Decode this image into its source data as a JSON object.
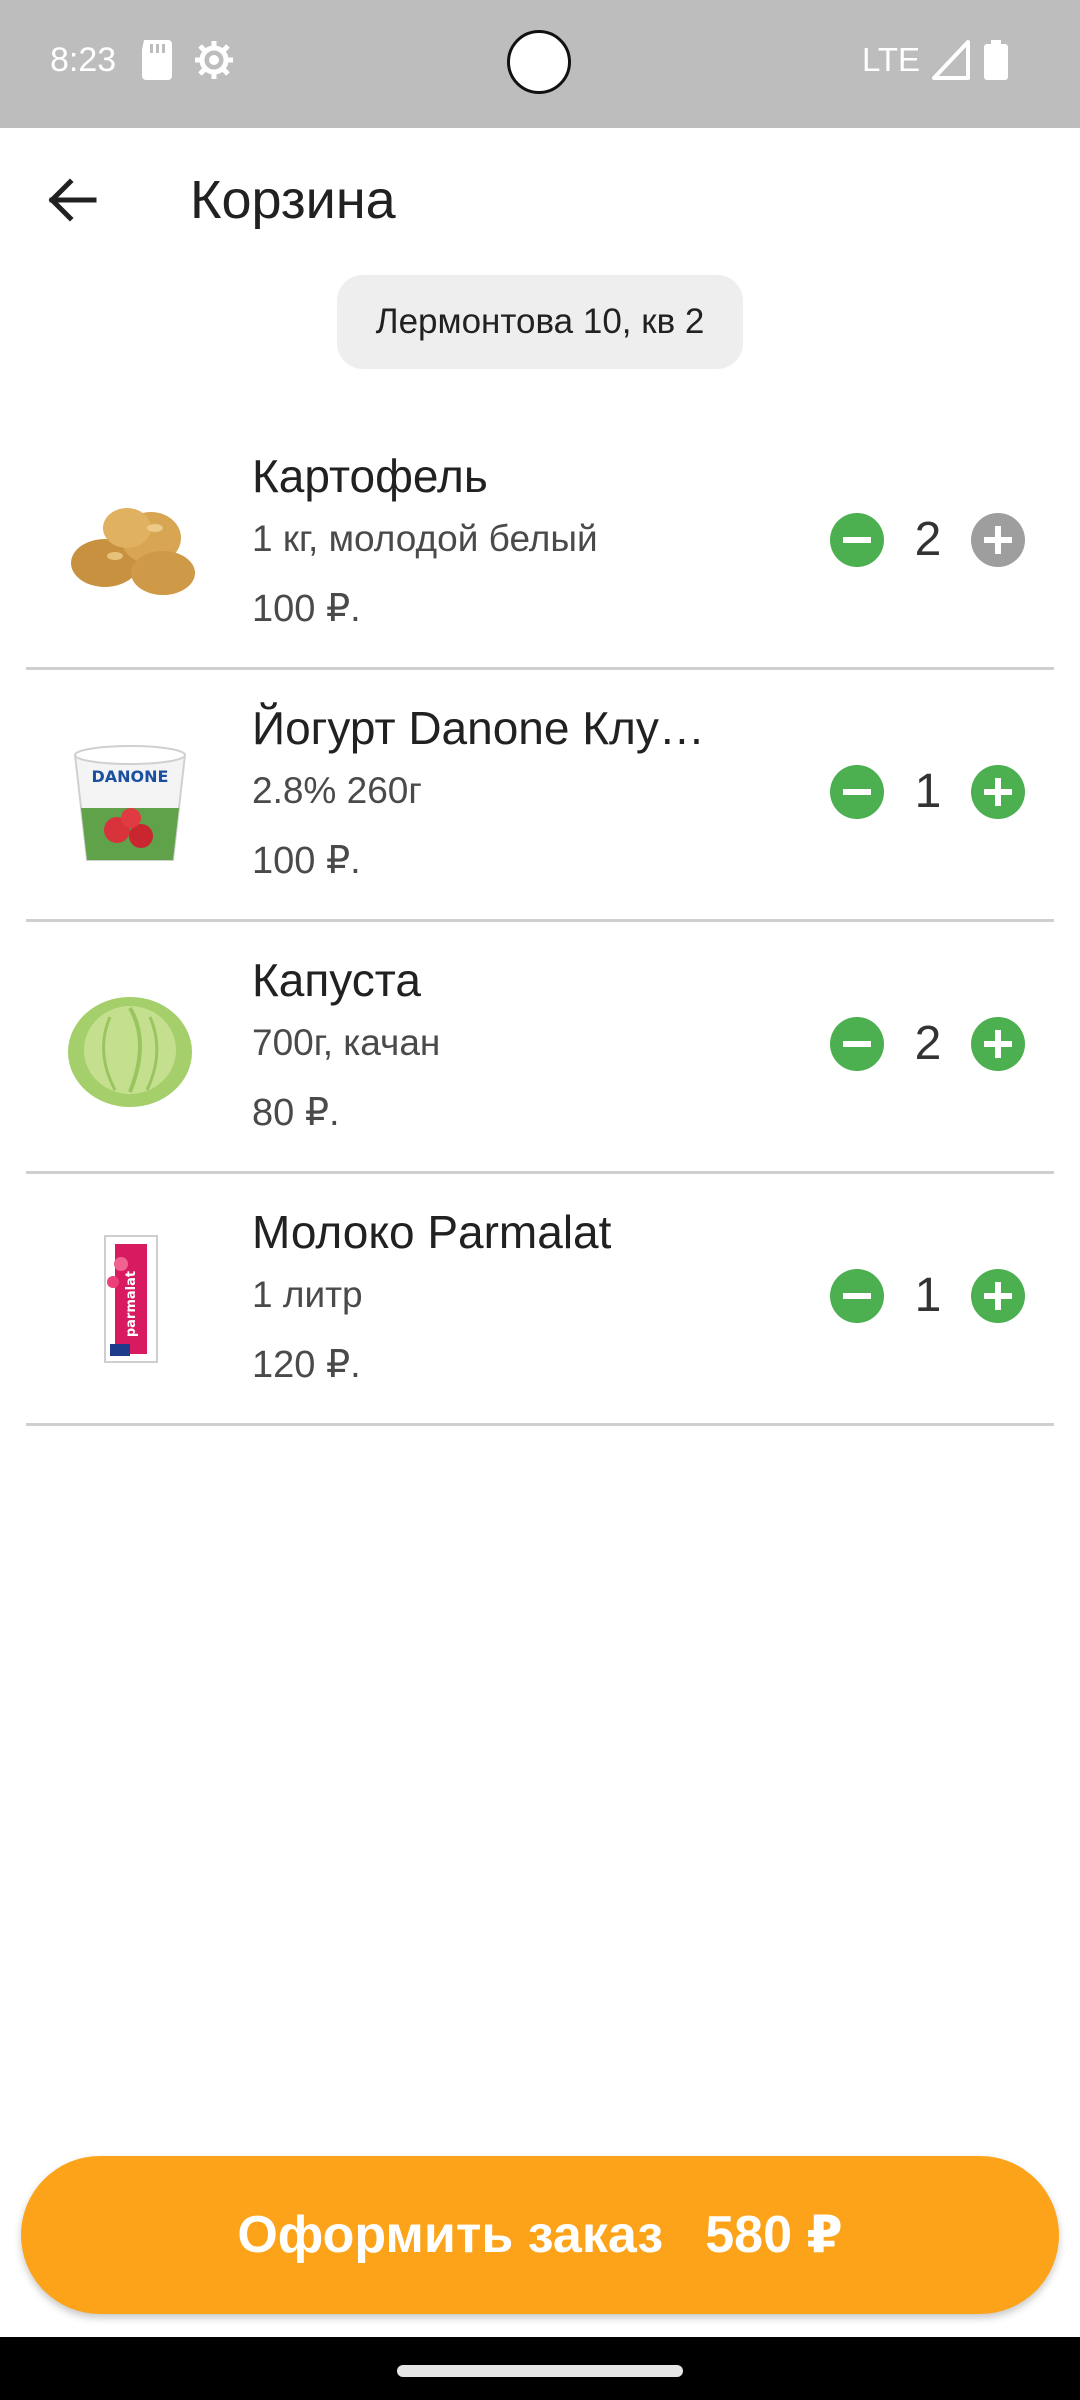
{
  "status_bar": {
    "time": "8:23",
    "network": "LTE",
    "icons": [
      "sd-card-icon",
      "settings-gear-icon",
      "signal-icon",
      "battery-icon"
    ]
  },
  "header": {
    "title": "Корзина",
    "back_icon": "arrow-left-icon"
  },
  "address": "Лермонтова 10, кв 2",
  "items": [
    {
      "name": "Картофель",
      "description": "1 кг, молодой белый",
      "price": "100 ₽.",
      "quantity": "2",
      "image": "potatoes"
    },
    {
      "name": "Йогурт Danone Клу…",
      "description": "2.8% 260г",
      "price": "100 ₽.",
      "quantity": "1",
      "image": "danone-yogurt",
      "image_brand": "DANONE"
    },
    {
      "name": "Капуста",
      "description": "700г, качан",
      "price": "80 ₽.",
      "quantity": "2",
      "image": "cabbage"
    },
    {
      "name": "Молоко Parmalat",
      "description": "1 литр",
      "price": "120 ₽.",
      "quantity": "1",
      "image": "parmalat-milk",
      "image_brand": "parmalat"
    }
  ],
  "checkout": {
    "label": "Оформить заказ",
    "total": "580 ₽"
  },
  "colors": {
    "accent_green": "#4caf50",
    "disabled_grey": "#9e9e9e",
    "checkout_orange": "#fca319",
    "status_bar": "#bdbdbd"
  }
}
